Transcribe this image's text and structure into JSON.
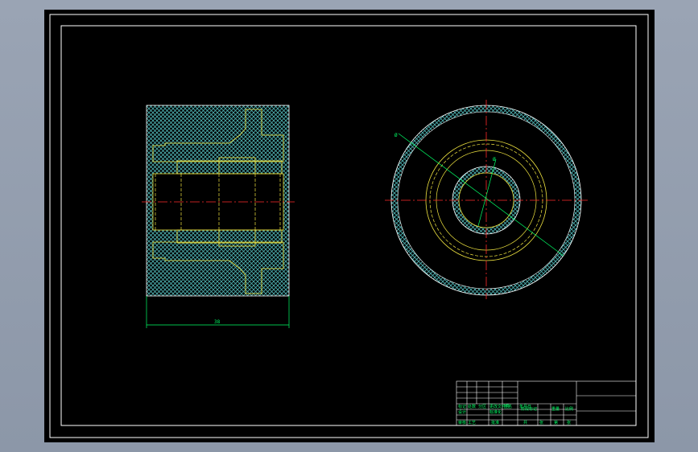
{
  "colors": {
    "background_outer": "#9aa4b4",
    "canvas": "#000000",
    "frame": "#ffffff",
    "hatch": "#4fb3b3",
    "outline": "#f2e640",
    "centerline": "#ff2a2a",
    "dimension": "#00ff66"
  },
  "section_view": {
    "width_dimension": "38"
  },
  "circular_view": {
    "outer_diameter_label": "Ø",
    "inner_diameter_label": "Ø"
  },
  "title_block": {
    "labels": [
      "标记",
      "处数",
      "分区",
      "更改文件号",
      "签名",
      "年月日",
      "设计",
      "标准化",
      "阶段标记",
      "重量",
      "比例",
      "审核",
      "工艺",
      "批准",
      "共",
      "张",
      "第",
      "张"
    ]
  }
}
